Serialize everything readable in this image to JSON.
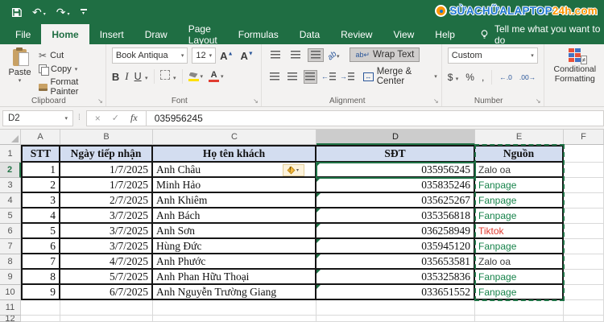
{
  "titlebar": {
    "logo_main": "SỬACHỮALAPTOP",
    "logo_suffix": "24h.com"
  },
  "icons": {
    "undo": "↶",
    "redo": "↷",
    "cut": "✂",
    "dropdown": "▾",
    "dialog_launcher": "↘",
    "cancel": "×",
    "check": "✓",
    "fx": "fx",
    "orientation": "ab",
    "wrap": "ab↵",
    "merge_arrows": "↔",
    "not_equal": "≠",
    "warning": "!",
    "indent_left": "←",
    "indent_right": "→"
  },
  "tabs": {
    "items": [
      {
        "id": "file",
        "label": "File",
        "active": false
      },
      {
        "id": "home",
        "label": "Home",
        "active": true
      },
      {
        "id": "insert",
        "label": "Insert",
        "active": false
      },
      {
        "id": "draw",
        "label": "Draw",
        "active": false
      },
      {
        "id": "page-layout",
        "label": "Page Layout",
        "active": false
      },
      {
        "id": "formulas",
        "label": "Formulas",
        "active": false
      },
      {
        "id": "data",
        "label": "Data",
        "active": false
      },
      {
        "id": "review",
        "label": "Review",
        "active": false
      },
      {
        "id": "view",
        "label": "View",
        "active": false
      },
      {
        "id": "help",
        "label": "Help",
        "active": false
      }
    ],
    "tell_me": "Tell me what you want to do"
  },
  "ribbon": {
    "clipboard": {
      "group": "Clipboard",
      "paste": "Paste",
      "cut": "Cut",
      "copy": "Copy",
      "format_painter": "Format Painter"
    },
    "font": {
      "group": "Font",
      "name": "Book Antiqua",
      "size": "12",
      "bold": "B",
      "italic": "I",
      "underline": "U",
      "grow": "A",
      "shrink": "A"
    },
    "alignment": {
      "group": "Alignment",
      "wrap": "Wrap Text",
      "merge": "Merge & Center"
    },
    "number": {
      "group": "Number",
      "format": "Custom",
      "currency": "$",
      "percent": "%",
      "comma": ",",
      "inc_decimal": "←.0",
      "dec_decimal": ".00→"
    },
    "styles": {
      "conditional_formatting_1": "Conditional",
      "conditional_formatting_2": "Formatting"
    }
  },
  "formula_bar": {
    "name_box": "D2",
    "value": "035956245"
  },
  "sheet": {
    "col_letters": [
      "A",
      "B",
      "C",
      "D",
      "E",
      "F"
    ],
    "active_col": "D",
    "active_row": "2",
    "row_numbers": [
      "1",
      "2",
      "3",
      "4",
      "5",
      "6",
      "7",
      "8",
      "9",
      "10",
      "11",
      "12"
    ],
    "header_row": [
      "STT",
      "Ngày tiếp nhận",
      "Họ tên khách",
      "SĐT",
      "Nguồn"
    ],
    "rows": [
      [
        "1",
        "1/7/2025",
        "Anh Châu",
        "035956245",
        "Zalo oa"
      ],
      [
        "2",
        "1/7/2025",
        "Minh Hảo",
        "035835246",
        "Fanpage"
      ],
      [
        "3",
        "2/7/2025",
        "Anh Khiêm",
        "035625267",
        "Fanpage"
      ],
      [
        "4",
        "3/7/2025",
        "Anh Bách",
        "035356818",
        "Fanpage"
      ],
      [
        "5",
        "3/7/2025",
        "Anh Sơn",
        "036258949",
        "Tiktok"
      ],
      [
        "6",
        "3/7/2025",
        "Hùng Đức",
        "035945120",
        "Fanpage"
      ],
      [
        "7",
        "4/7/2025",
        "Anh Phước",
        "035653581",
        "Zalo oa"
      ],
      [
        "8",
        "5/7/2025",
        "Anh Phan Hữu Thoại",
        "035325836",
        "Fanpage"
      ],
      [
        "9",
        "6/7/2025",
        "Anh Nguyễn Trường Giang",
        "033651552",
        "Fanpage"
      ]
    ],
    "source_colors": {
      "Zalo oa": "#3c3c3c",
      "Fanpage": "#16834a",
      "Tiktok": "#e03c31"
    }
  },
  "colors": {
    "excel_green": "#1f6e43",
    "selection_green": "#1e7145",
    "header_fill": "#d3ddf0",
    "logo_blue": "#1b75d0",
    "logo_orange": "#ff9500"
  }
}
